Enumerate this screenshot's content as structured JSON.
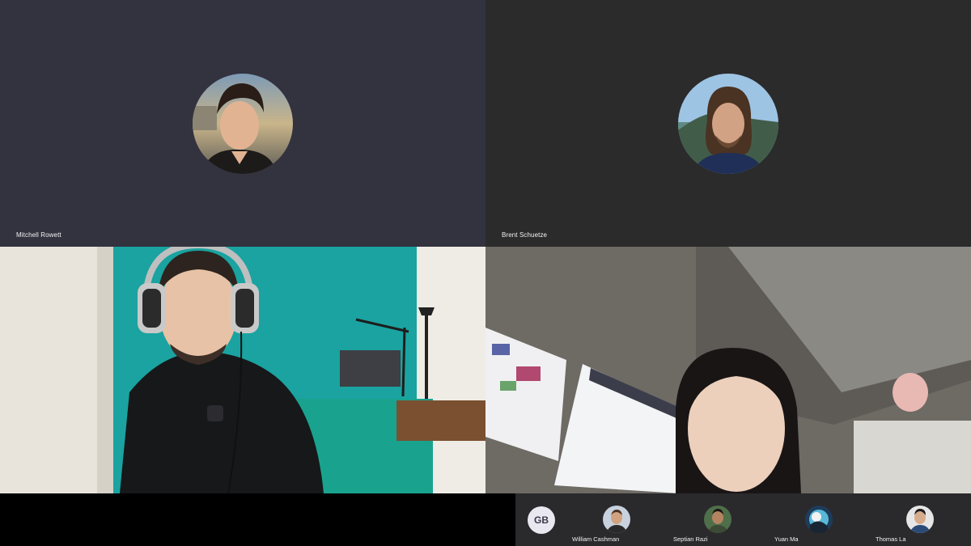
{
  "participants": [
    {
      "name": "Mitchell Rowett"
    },
    {
      "name": "Brent Schuetze"
    }
  ],
  "strip": {
    "self_initials": "GB",
    "people": [
      {
        "name": "William Cashman"
      },
      {
        "name": "Septian Razi"
      },
      {
        "name": "Yuan Ma"
      },
      {
        "name": "Thomas La"
      }
    ]
  },
  "colors": {
    "tile_bg_1": "#33323f",
    "tile_bg_2": "#2b2b2c",
    "strip_bg": "#2a2a2c"
  }
}
